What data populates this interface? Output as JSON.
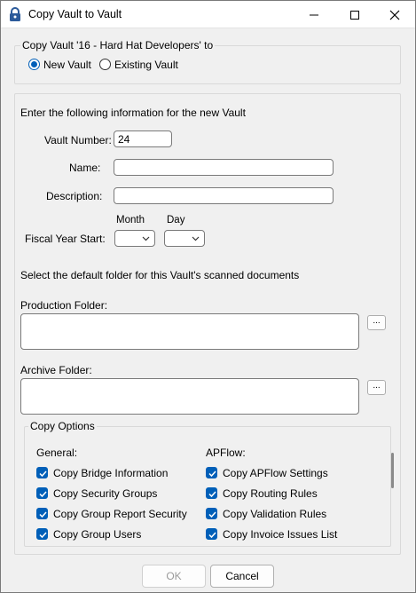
{
  "window": {
    "title": "Copy Vault to Vault",
    "icon": "padlock-icon"
  },
  "copy_group": {
    "legend": "Copy Vault '16 - Hard Hat Developers' to",
    "new_vault_label": "New Vault",
    "existing_vault_label": "Existing Vault",
    "selected": "New Vault"
  },
  "info": {
    "heading": "Enter the following information for the new Vault",
    "vault_number_label": "Vault Number:",
    "vault_number_value": "24",
    "name_label": "Name:",
    "name_value": "",
    "description_label": "Description:",
    "description_value": "",
    "month_label": "Month",
    "day_label": "Day",
    "fiscal_label": "Fiscal Year Start:",
    "folder_heading": "Select the default folder for this Vault's scanned documents",
    "production_label": "Production Folder:",
    "production_value": "",
    "archive_label": "Archive Folder:",
    "archive_value": "",
    "browse_label": "..."
  },
  "copy_options": {
    "legend": "Copy Options",
    "general_heading": "General:",
    "apflow_heading": "APFlow:",
    "general_items": [
      {
        "label": "Copy Bridge Information",
        "checked": true
      },
      {
        "label": "Copy Security Groups",
        "checked": true
      },
      {
        "label": "Copy Group Report Security",
        "checked": true
      },
      {
        "label": "Copy Group Users",
        "checked": true
      }
    ],
    "apflow_items": [
      {
        "label": "Copy APFlow Settings",
        "checked": true
      },
      {
        "label": "Copy Routing Rules",
        "checked": true
      },
      {
        "label": "Copy Validation Rules",
        "checked": true
      },
      {
        "label": "Copy Invoice Issues List",
        "checked": true
      }
    ]
  },
  "buttons": {
    "ok": "OK",
    "cancel": "Cancel"
  },
  "colors": {
    "accent": "#005fb8",
    "background": "#f0f0f0"
  }
}
